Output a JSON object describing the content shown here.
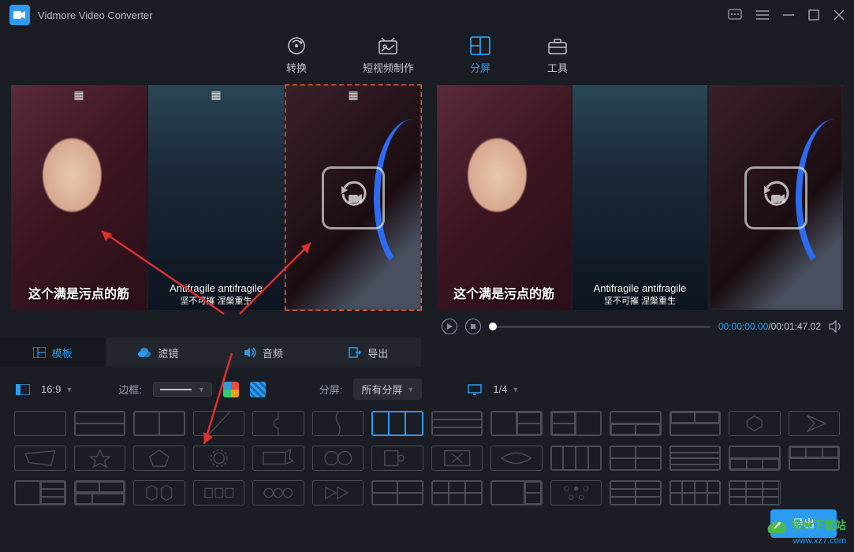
{
  "app": {
    "title": "Vidmore Video Converter"
  },
  "nav": {
    "convert": "转换",
    "shortVideo": "短视频制作",
    "split": "分屏",
    "tools": "工具"
  },
  "editCells": {
    "sub1": "这个满是污点的筋",
    "sub2_line1": "Antifragile antifragile",
    "sub2_line2": "坚不可摧 涅槃重生"
  },
  "playback": {
    "current": "00:00:00.00",
    "total": "00:01:47.02"
  },
  "tabs": {
    "template": "模板",
    "filter": "滤镜",
    "audio": "音频",
    "export": "导出"
  },
  "options": {
    "aspect": "16:9",
    "borderLabel": "边框:",
    "splitLabel": "分屏:",
    "splitAll": "所有分屏",
    "pageCount": "1/4"
  },
  "exportBtn": "导出",
  "watermark": {
    "brand": "极光下载站",
    "url": "www.xz7.com"
  }
}
